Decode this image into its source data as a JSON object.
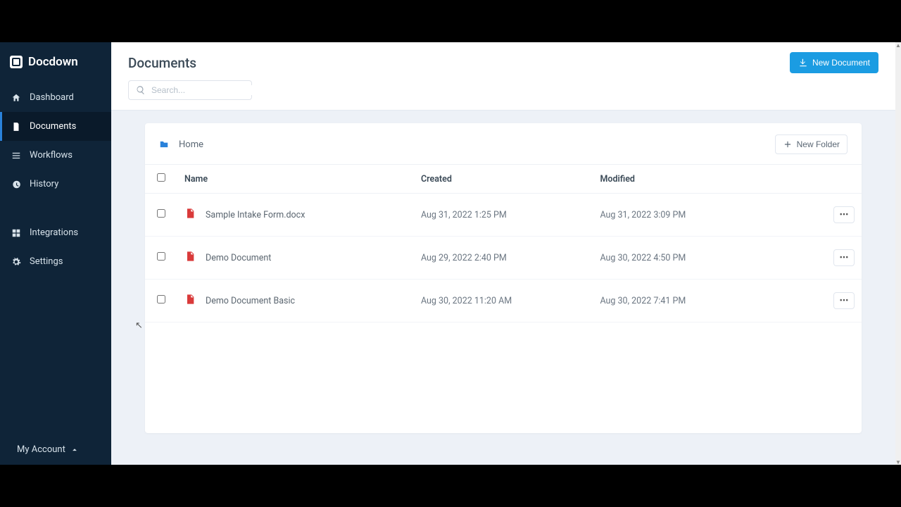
{
  "brand": {
    "name": "Docdown"
  },
  "sidebar": {
    "items": [
      {
        "label": "Dashboard"
      },
      {
        "label": "Documents"
      },
      {
        "label": "Workflows"
      },
      {
        "label": "History"
      },
      {
        "label": "Integrations"
      },
      {
        "label": "Settings"
      }
    ],
    "account_label": "My Account"
  },
  "header": {
    "title": "Documents",
    "new_document_label": "New Document"
  },
  "search": {
    "placeholder": "Search..."
  },
  "breadcrumb": {
    "home": "Home"
  },
  "toolbar": {
    "new_folder_label": "New Folder"
  },
  "table": {
    "columns": {
      "name": "Name",
      "created": "Created",
      "modified": "Modified"
    },
    "rows": [
      {
        "name": "Sample Intake Form.docx",
        "created": "Aug 31, 2022 1:25 PM",
        "modified": "Aug 31, 2022 3:09 PM"
      },
      {
        "name": "Demo Document",
        "created": "Aug 29, 2022 2:40 PM",
        "modified": "Aug 30, 2022 4:50 PM"
      },
      {
        "name": "Demo Document Basic",
        "created": "Aug 30, 2022 11:20 AM",
        "modified": "Aug 30, 2022 7:41 PM"
      }
    ]
  }
}
